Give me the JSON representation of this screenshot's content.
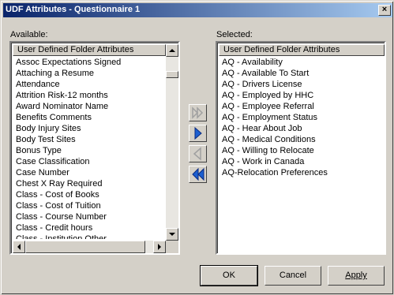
{
  "window": {
    "title": "UDF Attributes - Questionnaire 1",
    "close_glyph": "×"
  },
  "available": {
    "label": "Available:",
    "column_header": "User Defined Folder Attributes",
    "items": [
      "Assoc Expectations Signed",
      "Attaching a Resume",
      "Attendance",
      "Attrition Risk-12 months",
      "Award Nominator Name",
      "Benefits Comments",
      "Body Injury Sites",
      "Body Test Sites",
      "Bonus Type",
      "Case Classification",
      "Case Number",
      "Chest X Ray Required",
      "Class - Cost of Books",
      "Class - Cost of Tuition",
      "Class - Course Number",
      "Class - Credit hours",
      "Class - Institution  Other"
    ]
  },
  "selected": {
    "label": "Selected:",
    "column_header": "User Defined Folder Attributes",
    "items": [
      "AQ - Availability",
      "AQ - Available To Start",
      "AQ - Drivers License",
      "AQ - Employed by HHC",
      "AQ - Employee Referral",
      "AQ - Employment Status",
      "AQ - Hear About Job",
      "AQ - Medical Conditions",
      "AQ - Willing to Relocate",
      "AQ - Work in Canada",
      "AQ-Relocation Preferences"
    ]
  },
  "move_buttons": {
    "add_all_icon": "double-right-arrow-icon",
    "add_icon": "right-arrow-icon",
    "remove_icon": "left-arrow-icon",
    "remove_all_icon": "double-left-arrow-icon"
  },
  "colors": {
    "arrow_active": "#1c5fd0",
    "arrow_disabled": "#a0a0a0"
  },
  "buttons": {
    "ok": "OK",
    "cancel": "Cancel",
    "apply": "Apply"
  }
}
